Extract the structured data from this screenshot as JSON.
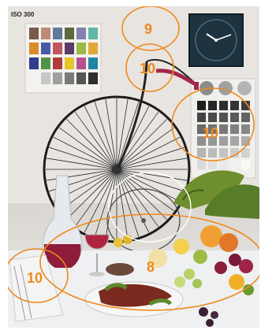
{
  "photo": {
    "iso_label": "ISO 300"
  },
  "annotations": {
    "color": "#ee8a1c",
    "labels": {
      "top_center": "9",
      "upper_center": "10",
      "right_chart": "10",
      "left_bottom": "10",
      "bottom_table": "8"
    }
  },
  "checker_colors": [
    "#7a5a4a",
    "#c08a78",
    "#5d7a9c",
    "#5c6a3e",
    "#8580b0",
    "#5fb7a8",
    "#d98a2c",
    "#4a5aa6",
    "#c1575c",
    "#5a3a6a",
    "#9cba44",
    "#e0a834",
    "#2f3d8e",
    "#4e9548",
    "#b13a3a",
    "#e7c62a",
    "#b7508c",
    "#1f86a4",
    "#f2f2f2",
    "#c8c8c8",
    "#a0a0a0",
    "#7a7a7a",
    "#555555",
    "#2e2e2e"
  ]
}
